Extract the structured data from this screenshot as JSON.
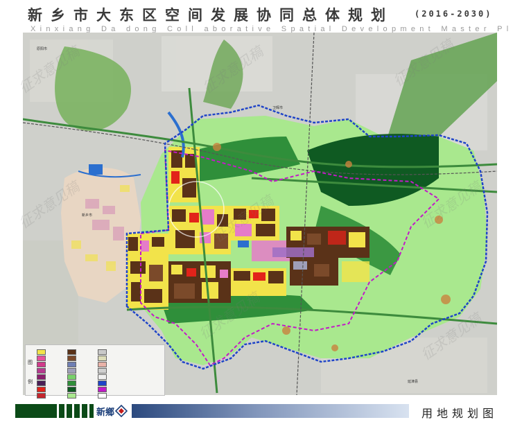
{
  "title": {
    "chinese": "新乡市大东区空间发展协同总体规划",
    "years": "(2016-2030)",
    "english": "Xinxiang Da dong Coll aborative Spatial Development Master Plan"
  },
  "map": {
    "places": [
      "原阳市",
      "卫辉市",
      "延津县",
      "新乡市"
    ],
    "colors": {
      "residential": "#f2e34a",
      "industrial": "#5a3218",
      "commercial": "#e2231a",
      "public": "#e57cc9",
      "green_space": "#2f8f3a",
      "agricultural": "#a9e88e",
      "forest": "#0f5a22",
      "water": "#2b6fcf",
      "boundary_blue": "#1f44c8",
      "boundary_magenta": "#c21ac7"
    }
  },
  "legend": {
    "label_top": "图",
    "label_bottom": "例",
    "items": [
      {
        "color": "#f2e34a"
      },
      {
        "color": "#e6519b"
      },
      {
        "color": "#d13a8a"
      },
      {
        "color": "#b63a8f"
      },
      {
        "color": "#8a1f6d"
      },
      {
        "color": "#4a1f56"
      },
      {
        "color": "#e2231a"
      },
      {
        "color": "#c4262d"
      },
      {
        "color": "#5a3218"
      },
      {
        "color": "#7b4a2a"
      },
      {
        "color": "#6f7fb4"
      },
      {
        "color": "#9f9fb9"
      },
      {
        "color": "#79d16b"
      },
      {
        "color": "#2f8f3a"
      },
      {
        "color": "#0f5a22"
      },
      {
        "color": "#a9e88e"
      },
      {
        "color": "#c9c9c9"
      },
      {
        "color": "#dcdcb8"
      },
      {
        "color": "#e8b2a8"
      },
      {
        "color": "#d0d0d0"
      },
      {
        "color": "#f0f0f0"
      },
      {
        "color": "#1f44c8"
      },
      {
        "color": "#c21ac7"
      },
      {
        "color": "#ffffff"
      }
    ]
  },
  "footer": {
    "logo_text": "新鄉",
    "map_name": "用地规划图"
  },
  "watermark": {
    "text": "征求意见稿"
  }
}
